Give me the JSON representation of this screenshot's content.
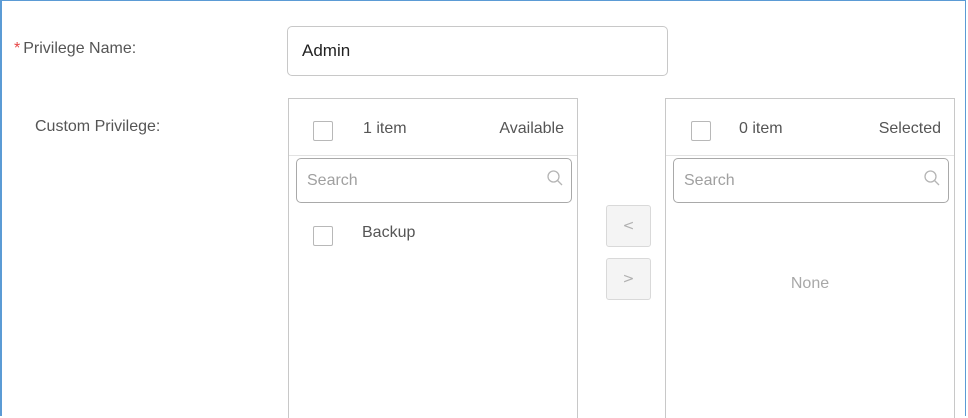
{
  "privilege_name": {
    "required_mark": "*",
    "label": "Privilege Name:",
    "value": "Admin"
  },
  "custom_privilege": {
    "label": "Custom Privilege:"
  },
  "available_panel": {
    "count_text": "1 item",
    "title": "Available",
    "search_placeholder": "Search",
    "items": [
      {
        "label": "Backup",
        "checked": false
      }
    ]
  },
  "selected_panel": {
    "count_text": "0 item",
    "title": "Selected",
    "search_placeholder": "Search",
    "empty_text": "None"
  },
  "transfer_buttons": {
    "move_left_glyph": "<",
    "move_right_glyph": ">"
  },
  "colors": {
    "frame_border": "#5b9bd5",
    "required_star": "#e64545",
    "border": "#c8c8c8"
  }
}
